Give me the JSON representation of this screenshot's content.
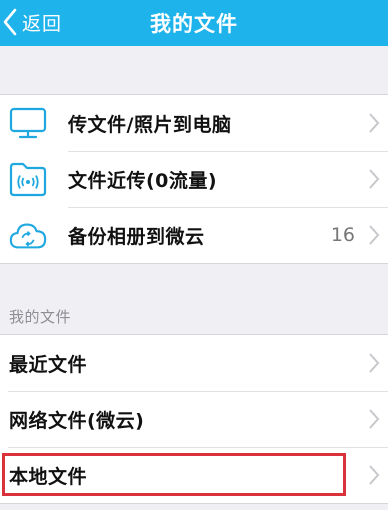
{
  "nav": {
    "back_label": "返回",
    "title": "我的文件"
  },
  "transfer": {
    "items": [
      {
        "icon": "monitor-icon",
        "label": "传文件/照片到电脑",
        "count": ""
      },
      {
        "icon": "wifi-folder-icon",
        "label": "文件近传(0流量)",
        "count": ""
      },
      {
        "icon": "cloud-sync-icon",
        "label": "备份相册到微云",
        "count": "16"
      }
    ]
  },
  "my_files": {
    "header": "我的文件",
    "items": [
      {
        "label": "最近文件"
      },
      {
        "label": "网络文件(微云)"
      },
      {
        "label": "本地文件"
      }
    ]
  },
  "colors": {
    "nav_background": "#1fb3ec",
    "icon_accent": "#1fa8e0",
    "highlight_border": "#d9323b"
  }
}
